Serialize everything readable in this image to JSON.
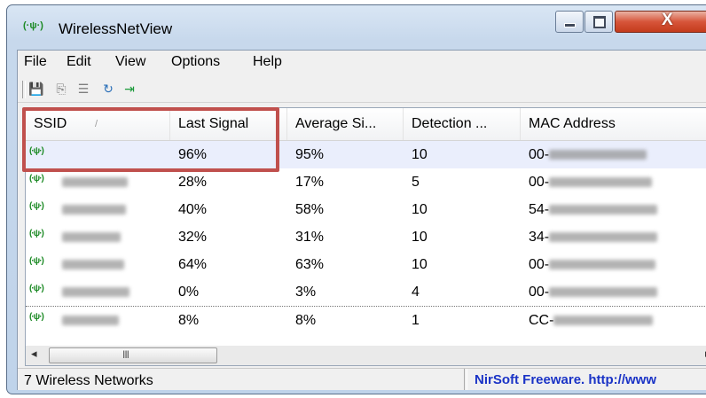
{
  "window": {
    "title": "WirelessNetView",
    "title_icon": "(·ψ·)",
    "controls": {
      "min_icon": "minimize-icon",
      "max_icon": "maximize-icon",
      "close_glyph": "X"
    }
  },
  "menu": [
    "File",
    "Edit",
    "View",
    "Options",
    "Help"
  ],
  "toolbar": {
    "icons": [
      "save-icon",
      "copy-icon",
      "properties-icon",
      "refresh-icon",
      "exit-icon"
    ],
    "glyphs": [
      "💾",
      "⎘",
      "☰",
      "↻",
      "⇥"
    ]
  },
  "columns": [
    "SSID",
    "Last Signal",
    "Average Si...",
    "Detection ...",
    "MAC Address"
  ],
  "sort_indicator": "/",
  "wifi_glyph": "(·ψ·)",
  "rows": [
    {
      "last_signal": "96%",
      "average_signal": "95%",
      "detection": "10",
      "mac_prefix": "00-",
      "selected": true
    },
    {
      "last_signal": "28%",
      "average_signal": "17%",
      "detection": "5",
      "mac_prefix": "00-"
    },
    {
      "last_signal": "40%",
      "average_signal": "58%",
      "detection": "10",
      "mac_prefix": "54-"
    },
    {
      "last_signal": "32%",
      "average_signal": "31%",
      "detection": "10",
      "mac_prefix": "34-"
    },
    {
      "last_signal": "64%",
      "average_signal": "63%",
      "detection": "10",
      "mac_prefix": "00-"
    },
    {
      "last_signal": "0%",
      "average_signal": "3%",
      "detection": "4",
      "mac_prefix": "00-"
    },
    {
      "last_signal": "8%",
      "average_signal": "8%",
      "detection": "1",
      "mac_prefix": "CC-"
    }
  ],
  "scrollbar": {
    "left_arrow": "◂",
    "right_arrow": "▸",
    "grip": "III"
  },
  "status": {
    "left": "7 Wireless Networks",
    "right": "NirSoft Freeware.  http://www"
  },
  "colors": {
    "highlight_box": "#c0504d",
    "link": "#1a33c6",
    "selection": "#eaeefc"
  }
}
